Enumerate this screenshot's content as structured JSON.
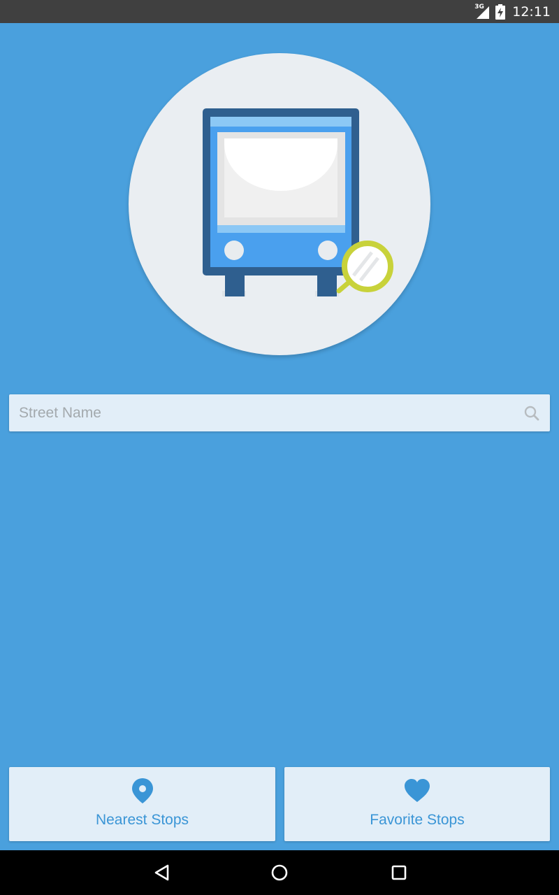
{
  "status_bar": {
    "network_type": "3G",
    "time": "12:11",
    "icons": [
      "signal-icon",
      "battery-charging-icon"
    ]
  },
  "hero": {
    "icon": "bus-search-illustration",
    "colors": {
      "circle": "#eaeef2",
      "bus_frame": "#2f5f8f",
      "bus_body": "#4aa0ee",
      "bus_stripe": "#8cc8f5",
      "magnifier_ring": "#c8d23a"
    }
  },
  "search": {
    "placeholder": "Street Name",
    "value": "",
    "icon": "search-icon"
  },
  "buttons": {
    "nearest": {
      "label": "Nearest Stops",
      "icon": "location-pin-icon"
    },
    "favorite": {
      "label": "Favorite Stops",
      "icon": "heart-icon"
    }
  },
  "nav_bar": {
    "icons": [
      "back-icon",
      "home-icon",
      "recents-icon"
    ]
  },
  "colors": {
    "background": "#4aa0dd",
    "panel": "#e2eef8",
    "accent": "#3a95d6",
    "status_bar": "#404040",
    "nav_bar": "#000000"
  }
}
